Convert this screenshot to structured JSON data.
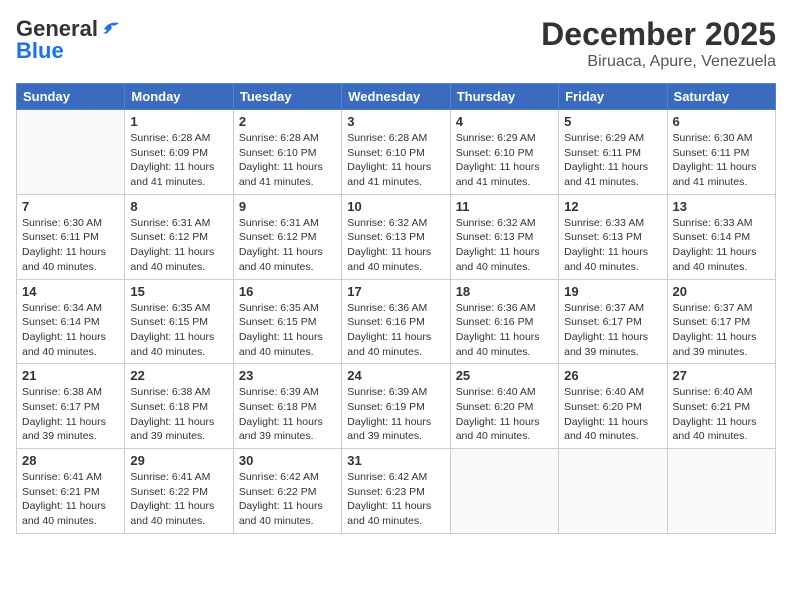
{
  "header": {
    "logo_general": "General",
    "logo_blue": "Blue",
    "month_title": "December 2025",
    "location": "Biruaca, Apure, Venezuela"
  },
  "weekdays": [
    "Sunday",
    "Monday",
    "Tuesday",
    "Wednesday",
    "Thursday",
    "Friday",
    "Saturday"
  ],
  "weeks": [
    [
      {
        "day": "",
        "sunrise": "",
        "sunset": "",
        "daylight": ""
      },
      {
        "day": "1",
        "sunrise": "Sunrise: 6:28 AM",
        "sunset": "Sunset: 6:09 PM",
        "daylight": "Daylight: 11 hours and 41 minutes."
      },
      {
        "day": "2",
        "sunrise": "Sunrise: 6:28 AM",
        "sunset": "Sunset: 6:10 PM",
        "daylight": "Daylight: 11 hours and 41 minutes."
      },
      {
        "day": "3",
        "sunrise": "Sunrise: 6:28 AM",
        "sunset": "Sunset: 6:10 PM",
        "daylight": "Daylight: 11 hours and 41 minutes."
      },
      {
        "day": "4",
        "sunrise": "Sunrise: 6:29 AM",
        "sunset": "Sunset: 6:10 PM",
        "daylight": "Daylight: 11 hours and 41 minutes."
      },
      {
        "day": "5",
        "sunrise": "Sunrise: 6:29 AM",
        "sunset": "Sunset: 6:11 PM",
        "daylight": "Daylight: 11 hours and 41 minutes."
      },
      {
        "day": "6",
        "sunrise": "Sunrise: 6:30 AM",
        "sunset": "Sunset: 6:11 PM",
        "daylight": "Daylight: 11 hours and 41 minutes."
      }
    ],
    [
      {
        "day": "7",
        "sunrise": "Sunrise: 6:30 AM",
        "sunset": "Sunset: 6:11 PM",
        "daylight": "Daylight: 11 hours and 40 minutes."
      },
      {
        "day": "8",
        "sunrise": "Sunrise: 6:31 AM",
        "sunset": "Sunset: 6:12 PM",
        "daylight": "Daylight: 11 hours and 40 minutes."
      },
      {
        "day": "9",
        "sunrise": "Sunrise: 6:31 AM",
        "sunset": "Sunset: 6:12 PM",
        "daylight": "Daylight: 11 hours and 40 minutes."
      },
      {
        "day": "10",
        "sunrise": "Sunrise: 6:32 AM",
        "sunset": "Sunset: 6:13 PM",
        "daylight": "Daylight: 11 hours and 40 minutes."
      },
      {
        "day": "11",
        "sunrise": "Sunrise: 6:32 AM",
        "sunset": "Sunset: 6:13 PM",
        "daylight": "Daylight: 11 hours and 40 minutes."
      },
      {
        "day": "12",
        "sunrise": "Sunrise: 6:33 AM",
        "sunset": "Sunset: 6:13 PM",
        "daylight": "Daylight: 11 hours and 40 minutes."
      },
      {
        "day": "13",
        "sunrise": "Sunrise: 6:33 AM",
        "sunset": "Sunset: 6:14 PM",
        "daylight": "Daylight: 11 hours and 40 minutes."
      }
    ],
    [
      {
        "day": "14",
        "sunrise": "Sunrise: 6:34 AM",
        "sunset": "Sunset: 6:14 PM",
        "daylight": "Daylight: 11 hours and 40 minutes."
      },
      {
        "day": "15",
        "sunrise": "Sunrise: 6:35 AM",
        "sunset": "Sunset: 6:15 PM",
        "daylight": "Daylight: 11 hours and 40 minutes."
      },
      {
        "day": "16",
        "sunrise": "Sunrise: 6:35 AM",
        "sunset": "Sunset: 6:15 PM",
        "daylight": "Daylight: 11 hours and 40 minutes."
      },
      {
        "day": "17",
        "sunrise": "Sunrise: 6:36 AM",
        "sunset": "Sunset: 6:16 PM",
        "daylight": "Daylight: 11 hours and 40 minutes."
      },
      {
        "day": "18",
        "sunrise": "Sunrise: 6:36 AM",
        "sunset": "Sunset: 6:16 PM",
        "daylight": "Daylight: 11 hours and 40 minutes."
      },
      {
        "day": "19",
        "sunrise": "Sunrise: 6:37 AM",
        "sunset": "Sunset: 6:17 PM",
        "daylight": "Daylight: 11 hours and 39 minutes."
      },
      {
        "day": "20",
        "sunrise": "Sunrise: 6:37 AM",
        "sunset": "Sunset: 6:17 PM",
        "daylight": "Daylight: 11 hours and 39 minutes."
      }
    ],
    [
      {
        "day": "21",
        "sunrise": "Sunrise: 6:38 AM",
        "sunset": "Sunset: 6:17 PM",
        "daylight": "Daylight: 11 hours and 39 minutes."
      },
      {
        "day": "22",
        "sunrise": "Sunrise: 6:38 AM",
        "sunset": "Sunset: 6:18 PM",
        "daylight": "Daylight: 11 hours and 39 minutes."
      },
      {
        "day": "23",
        "sunrise": "Sunrise: 6:39 AM",
        "sunset": "Sunset: 6:18 PM",
        "daylight": "Daylight: 11 hours and 39 minutes."
      },
      {
        "day": "24",
        "sunrise": "Sunrise: 6:39 AM",
        "sunset": "Sunset: 6:19 PM",
        "daylight": "Daylight: 11 hours and 39 minutes."
      },
      {
        "day": "25",
        "sunrise": "Sunrise: 6:40 AM",
        "sunset": "Sunset: 6:20 PM",
        "daylight": "Daylight: 11 hours and 40 minutes."
      },
      {
        "day": "26",
        "sunrise": "Sunrise: 6:40 AM",
        "sunset": "Sunset: 6:20 PM",
        "daylight": "Daylight: 11 hours and 40 minutes."
      },
      {
        "day": "27",
        "sunrise": "Sunrise: 6:40 AM",
        "sunset": "Sunset: 6:21 PM",
        "daylight": "Daylight: 11 hours and 40 minutes."
      }
    ],
    [
      {
        "day": "28",
        "sunrise": "Sunrise: 6:41 AM",
        "sunset": "Sunset: 6:21 PM",
        "daylight": "Daylight: 11 hours and 40 minutes."
      },
      {
        "day": "29",
        "sunrise": "Sunrise: 6:41 AM",
        "sunset": "Sunset: 6:22 PM",
        "daylight": "Daylight: 11 hours and 40 minutes."
      },
      {
        "day": "30",
        "sunrise": "Sunrise: 6:42 AM",
        "sunset": "Sunset: 6:22 PM",
        "daylight": "Daylight: 11 hours and 40 minutes."
      },
      {
        "day": "31",
        "sunrise": "Sunrise: 6:42 AM",
        "sunset": "Sunset: 6:23 PM",
        "daylight": "Daylight: 11 hours and 40 minutes."
      },
      {
        "day": "",
        "sunrise": "",
        "sunset": "",
        "daylight": ""
      },
      {
        "day": "",
        "sunrise": "",
        "sunset": "",
        "daylight": ""
      },
      {
        "day": "",
        "sunrise": "",
        "sunset": "",
        "daylight": ""
      }
    ]
  ]
}
